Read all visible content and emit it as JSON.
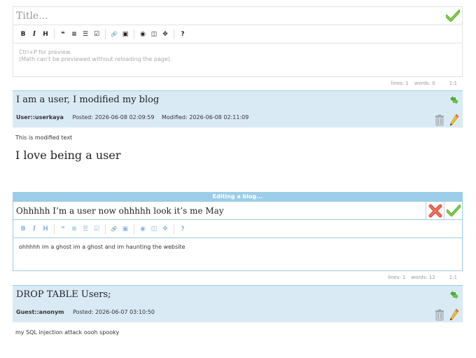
{
  "new_post": {
    "title_placeholder": "Title...",
    "preview_hint": "Ctrl+P for preview.",
    "math_hint": "(Math can't be previewed without reloading the page).",
    "status": {
      "lines": "lines: 1",
      "words": "words: 0",
      "cursor": "1:1"
    }
  },
  "toolbar": [
    "B",
    "I",
    "H",
    "❝",
    "≡",
    "☰",
    "☑",
    "🔗",
    "▣",
    "◉",
    "◫",
    "✥",
    "?"
  ],
  "posts": [
    {
      "title": "I am a user, I modified my blog",
      "author": "User::userkaya",
      "posted": "Posted: 2026-06-08 02:09:59",
      "modified": "Modified: 2026-06-08 02:11:09",
      "body_small": "This is modified text",
      "body_big": "I love being a user"
    },
    {
      "title": "DROP TABLE Users;",
      "author": "Guest::anonym",
      "posted": "Posted: 2026-06-07 03:10:50",
      "body_small": "my SQL injection attack oooh spooky"
    }
  ],
  "edit": {
    "banner": "Editing a blog...",
    "title_value": "Ohhhhh I’m a user now ohhhhh look it’s me May",
    "body": "ohhhhh im a ghost im a ghost and im haunting the website",
    "status": {
      "lines": "lines: 1",
      "words": "words: 12",
      "cursor": "1:1"
    }
  },
  "colors": {
    "post_bg": "#d9eaf5",
    "accent": "#9ccde8",
    "check": "#5ab22c",
    "cross": "#e05540"
  }
}
